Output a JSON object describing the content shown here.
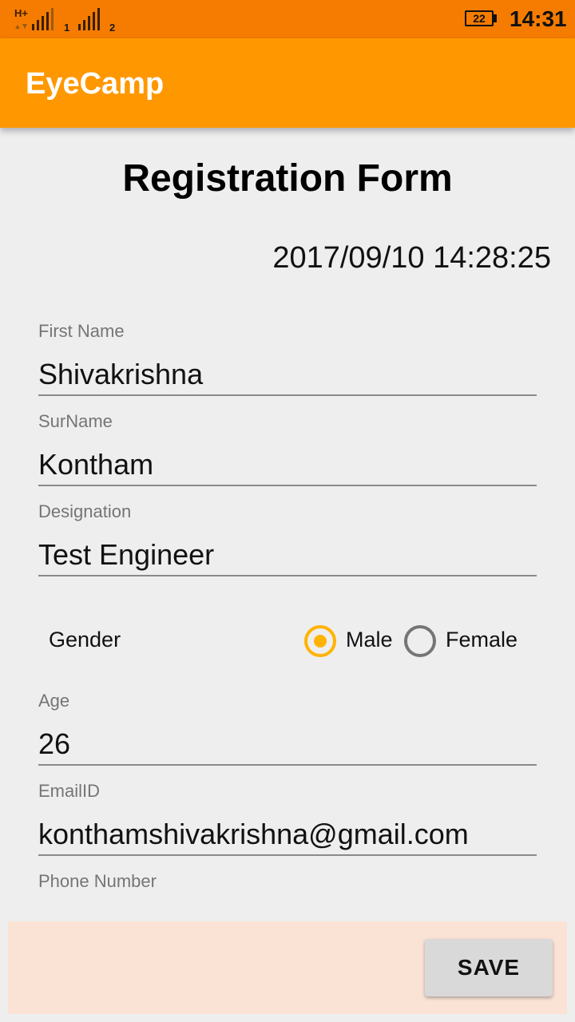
{
  "status_bar": {
    "network": "H+",
    "sim1": "1",
    "sim2": "2",
    "battery": "22",
    "time": "14:31"
  },
  "app_bar": {
    "title": "EyeCamp"
  },
  "form": {
    "title": "Registration Form",
    "timestamp": "2017/09/10 14:28:25",
    "first_name": {
      "label": "First Name",
      "value": "Shivakrishna"
    },
    "surname": {
      "label": "SurName",
      "value": "Kontham"
    },
    "designation": {
      "label": "Designation",
      "value": "Test Engineer"
    },
    "gender": {
      "label": "Gender",
      "options": [
        "Male",
        "Female"
      ],
      "selected": "Male"
    },
    "age": {
      "label": "Age",
      "value": "26"
    },
    "email": {
      "label": "EmailID",
      "value": "konthamshivakrishna@gmail.com"
    },
    "phone": {
      "label": "Phone Number"
    }
  },
  "actions": {
    "save_label": "SAVE"
  },
  "colors": {
    "status_bar": "#f57c00",
    "app_bar": "#ff9800",
    "radio_accent": "#ffb300",
    "bottom_bar": "#fae3d5"
  }
}
